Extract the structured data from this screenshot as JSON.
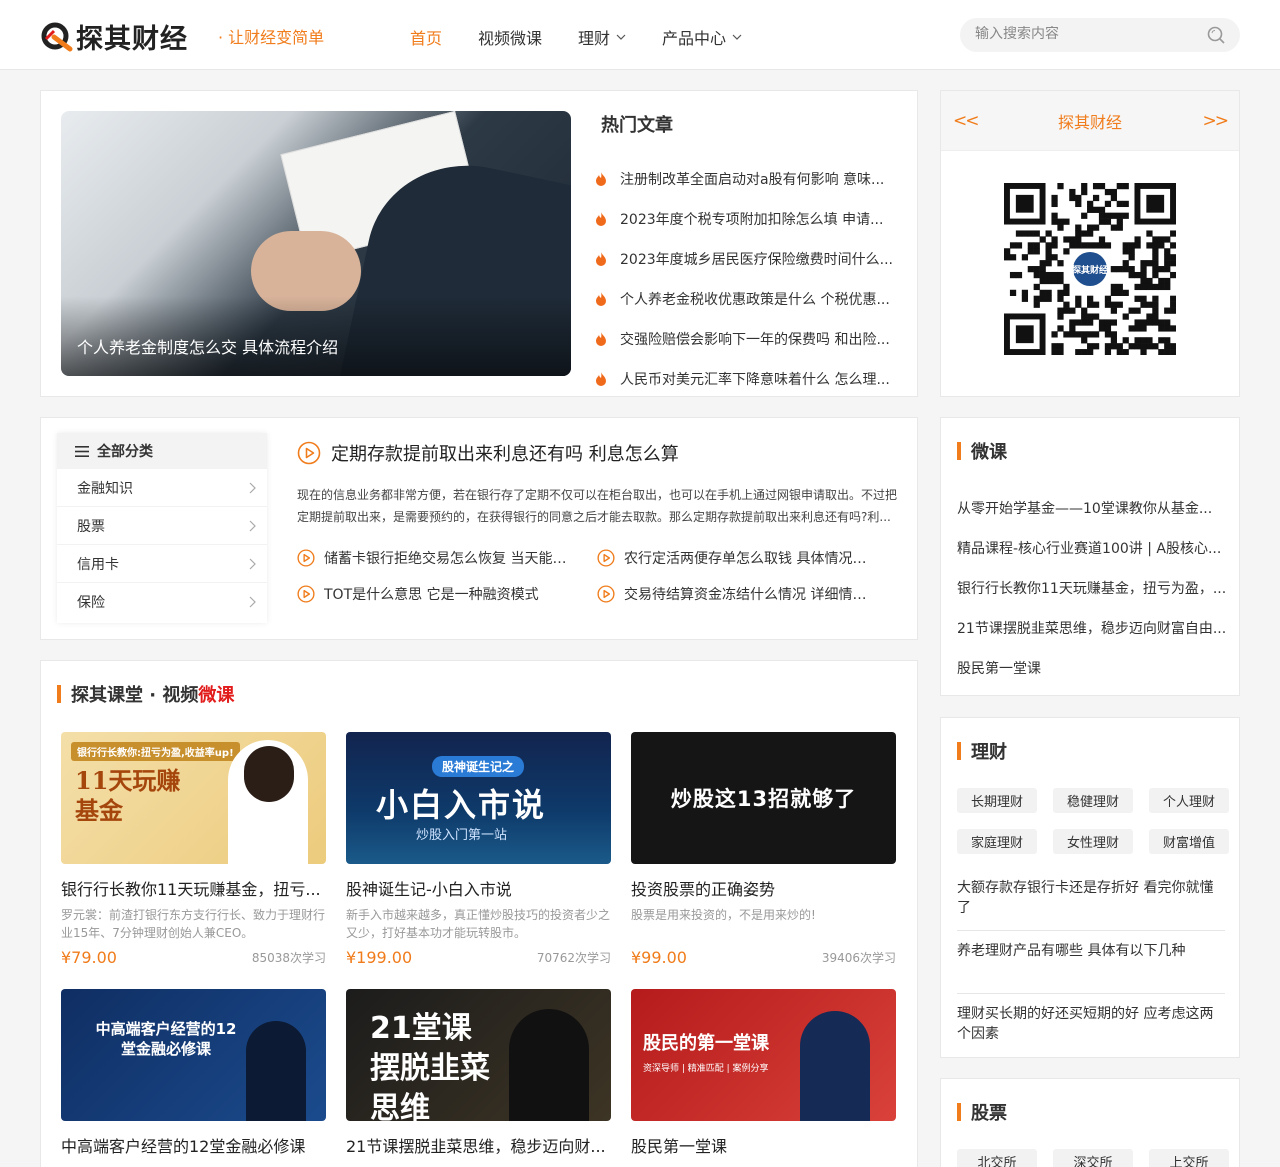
{
  "header": {
    "logo_text": "探其财经",
    "slogan": "· 让财经变简单",
    "nav": [
      {
        "label": "首页",
        "active": true,
        "dropdown": false
      },
      {
        "label": "视频微课",
        "active": false,
        "dropdown": false
      },
      {
        "label": "理财",
        "active": false,
        "dropdown": true
      },
      {
        "label": "产品中心",
        "active": false,
        "dropdown": true
      }
    ],
    "search_placeholder": "输入搜索内容"
  },
  "hero": {
    "caption": "个人养老金制度怎么交 具体流程介绍"
  },
  "hot": {
    "title": "热门文章",
    "items": [
      "注册制改革全面启动对a股有何影响 意味...",
      "2023年度个税专项附加扣除怎么填 申请...",
      "2023年度城乡居民医疗保险缴费时间什么...",
      "个人养老金税收优惠政策是什么 个税优惠...",
      "交强险赔偿会影响下一年的保费吗 和出险...",
      "人民币对美元汇率下降意味着什么 怎么理..."
    ]
  },
  "qr": {
    "title": "探其财经",
    "prev": "<<",
    "next": ">>",
    "badge": "探其财经"
  },
  "category": {
    "head": "全部分类",
    "items": [
      "金融知识",
      "股票",
      "信用卡",
      "保险"
    ],
    "article_title": "定期存款提前取出来利息还有吗 利息怎么算",
    "article_desc": "现在的信息业务都非常方便，若在银行存了定期不仅可以在柜台取出，也可以在手机上通过网银申请取出。不过把定期提前取出来，是需要预约的，在获得银行的同意之后才能去取款。那么定期存款提前取出来利息还有吗?利...",
    "links": [
      "储蓄卡银行拒绝交易怎么恢复 当天能恢...",
      "农行定活两便存单怎么取钱 具体情况如...",
      "TOT是什么意思 它是一种融资模式",
      "交易待结算资金冻结什么情况 详细情况..."
    ]
  },
  "courses_section": {
    "title_a": "探其课堂 · 视频",
    "title_b": "微课",
    "courses": [
      {
        "thumb_text": "11天玩赚基金",
        "thumb_tag": "银行行长教你:扭亏为盈,收益率up!",
        "name": "银行行长教你11天玩赚基金，扭亏...",
        "desc": "罗元裳：前渣打银行东方支行行长、致力于理财行业15年、7分钟理财创始人兼CEO。",
        "price": "¥79.00",
        "learners": "85038次学习"
      },
      {
        "thumb_text": "小白入市说",
        "thumb_tag": "股神诞生记之",
        "thumb_sub": "炒股入门第一站",
        "name": "股神诞生记-小白入市说",
        "desc": "新手入市越来越多，真正懂炒股技巧的投资者少之又少，打好基本功才能玩转股市。",
        "price": "¥199.00",
        "learners": "70762次学习"
      },
      {
        "thumb_text": "炒股这13招就够了",
        "name": "投资股票的正确姿势",
        "desc": "股票是用来投资的，不是用来炒的!",
        "price": "¥99.00",
        "learners": "39406次学习"
      },
      {
        "thumb_text": "中高端客户经营的12堂金融必修课",
        "name": "中高端客户经营的12堂金融必修课",
        "desc": "",
        "price": "",
        "learners": ""
      },
      {
        "thumb_text": "21堂课 摆脱韭菜思维",
        "name": "21节课摆脱韭菜思维，稳步迈向财...",
        "desc": "",
        "price": "",
        "learners": ""
      },
      {
        "thumb_text": "股民的第一堂课",
        "thumb_sub": "资深导师 | 精准匹配 | 案例分享",
        "name": "股民第一堂课",
        "desc": "",
        "price": "",
        "learners": ""
      }
    ]
  },
  "weike": {
    "title": "微课",
    "items": [
      "从零开始学基金——10堂课教你从基金...",
      "精品课程-核心行业赛道100讲 | A股核心...",
      "银行行长教你11天玩赚基金，扭亏为盈，...",
      "21节课摆脱韭菜思维，稳步迈向财富自由...",
      "股民第一堂课"
    ]
  },
  "licai": {
    "title": "理财",
    "tags": [
      "长期理财",
      "稳健理财",
      "个人理财",
      "家庭理财",
      "女性理财",
      "财富增值"
    ],
    "items": [
      "大额存款存银行卡还是存折好 看完你就懂了",
      "养老理财产品有哪些 具体有以下几种",
      "理财买长期的好还买短期的好 应考虑这两个因素"
    ]
  },
  "gupiao": {
    "title": "股票",
    "tags": [
      "北交所",
      "深交所",
      "上交所"
    ]
  },
  "colors": {
    "accent": "#f07c1b",
    "red": "#e21b1b"
  }
}
